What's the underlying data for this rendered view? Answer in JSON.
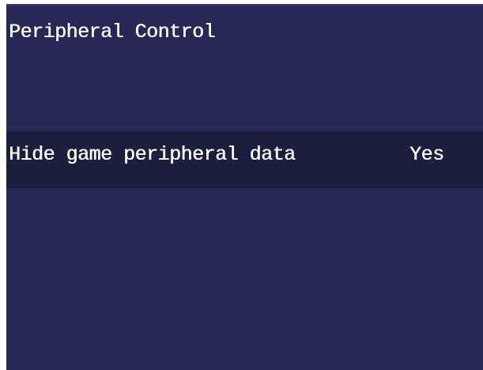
{
  "menu": {
    "title": "Peripheral Control",
    "options": [
      {
        "label": "Hide game peripheral data",
        "value": "Yes",
        "selected": true
      }
    ]
  },
  "colors": {
    "background": "#282856",
    "highlight": "#1b1f3d",
    "text": "#ffffff"
  }
}
